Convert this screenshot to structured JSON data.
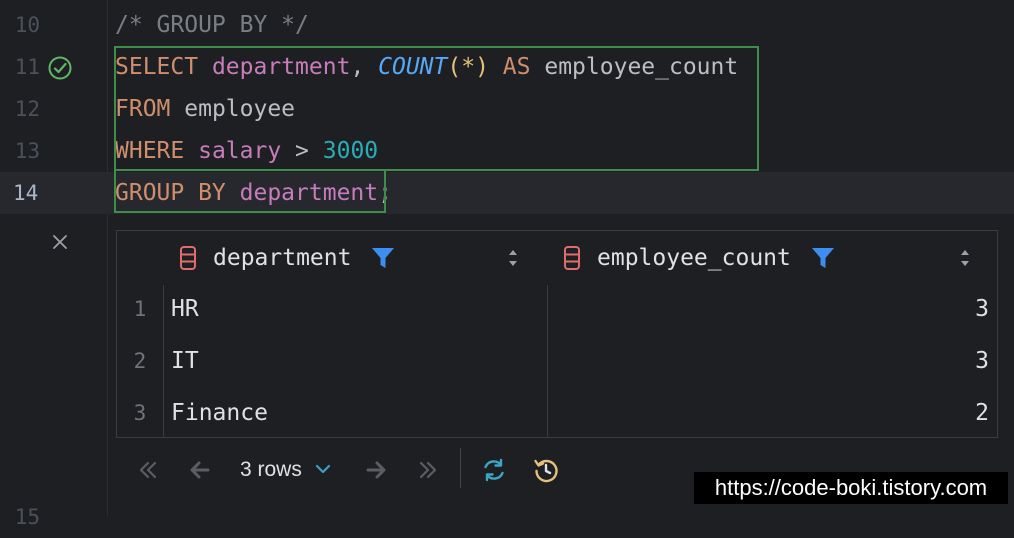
{
  "editor": {
    "line_numbers": [
      "10",
      "11",
      "12",
      "13",
      "14",
      "15"
    ],
    "lines": [
      {
        "comment": "/* GROUP BY */"
      },
      {
        "kw1": "SELECT",
        "col1": "department",
        "sep": ", ",
        "fn": "COUNT",
        "paren": "(*)",
        "kw2": "AS",
        "alias": "employee_count"
      },
      {
        "kw": "FROM",
        "table": "employee"
      },
      {
        "kw": "WHERE",
        "col": "salary",
        "op": " > ",
        "num": "3000"
      },
      {
        "kw": "GROUP BY",
        "col": "department",
        "end": ";"
      }
    ]
  },
  "results": {
    "columns": [
      "department",
      "employee_count"
    ],
    "rows": [
      {
        "num": "1",
        "department": "HR",
        "employee_count": "3"
      },
      {
        "num": "2",
        "department": "IT",
        "employee_count": "3"
      },
      {
        "num": "3",
        "department": "Finance",
        "employee_count": "2"
      }
    ]
  },
  "toolbar": {
    "rows_label": "3 rows"
  },
  "watermark": "https://code-boki.tistory.com",
  "colors": {
    "keyword": "#cf8e6d",
    "column": "#c77dbb",
    "function": "#56a8f5",
    "number": "#2aacb8",
    "selection_border": "#3e8e4a",
    "filter": "#3d8ef0"
  }
}
